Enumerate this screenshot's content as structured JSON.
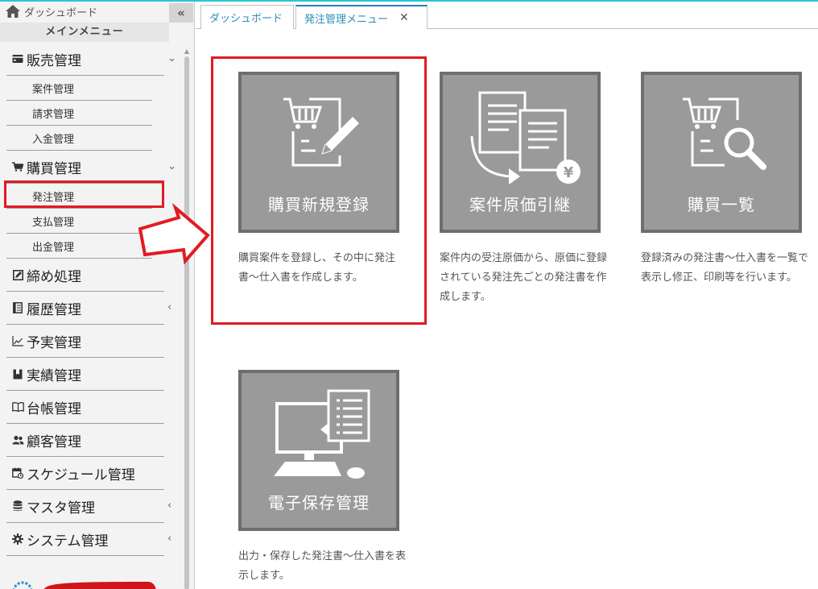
{
  "sidebar": {
    "dashboard_label": "ダッシュボード",
    "collapse_label": "«",
    "main_menu_title": "メインメニュー",
    "sales": {
      "label": "販売管理",
      "subs": [
        "案件管理",
        "請求管理",
        "入金管理"
      ]
    },
    "purchase": {
      "label": "購買管理",
      "subs": [
        "発注管理",
        "支払管理",
        "出金管理"
      ]
    },
    "items": [
      {
        "label": "締め処理"
      },
      {
        "label": "履歴管理"
      },
      {
        "label": "予実管理"
      },
      {
        "label": "実績管理"
      },
      {
        "label": "台帳管理"
      },
      {
        "label": "顧客管理"
      },
      {
        "label": "スケジュール管理"
      },
      {
        "label": "マスタ管理"
      },
      {
        "label": "システム管理"
      }
    ]
  },
  "tabs": {
    "dashboard": "ダッシュボード",
    "order_menu": "発注管理メニュー",
    "close_glyph": "✕"
  },
  "tiles": [
    {
      "label": "購買新規登録",
      "desc": "購買案件を登録し、その中に発注書〜仕入書を作成します。"
    },
    {
      "label": "案件原価引継",
      "desc": "案件内の受注原価から、原価に登録されている発注先ごとの発注書を作成します。"
    },
    {
      "label": "購買一覧",
      "desc": "登録済みの発注書〜仕入書を一覧で表示し修正、印刷等を行います。"
    },
    {
      "label": "電子保存管理",
      "desc": "出力・保存した発注書〜仕入書を表示します。"
    }
  ],
  "colors": {
    "accent": "#2a8fb8",
    "tile_bg": "#9a9a9a",
    "highlight": "#e01b24"
  }
}
